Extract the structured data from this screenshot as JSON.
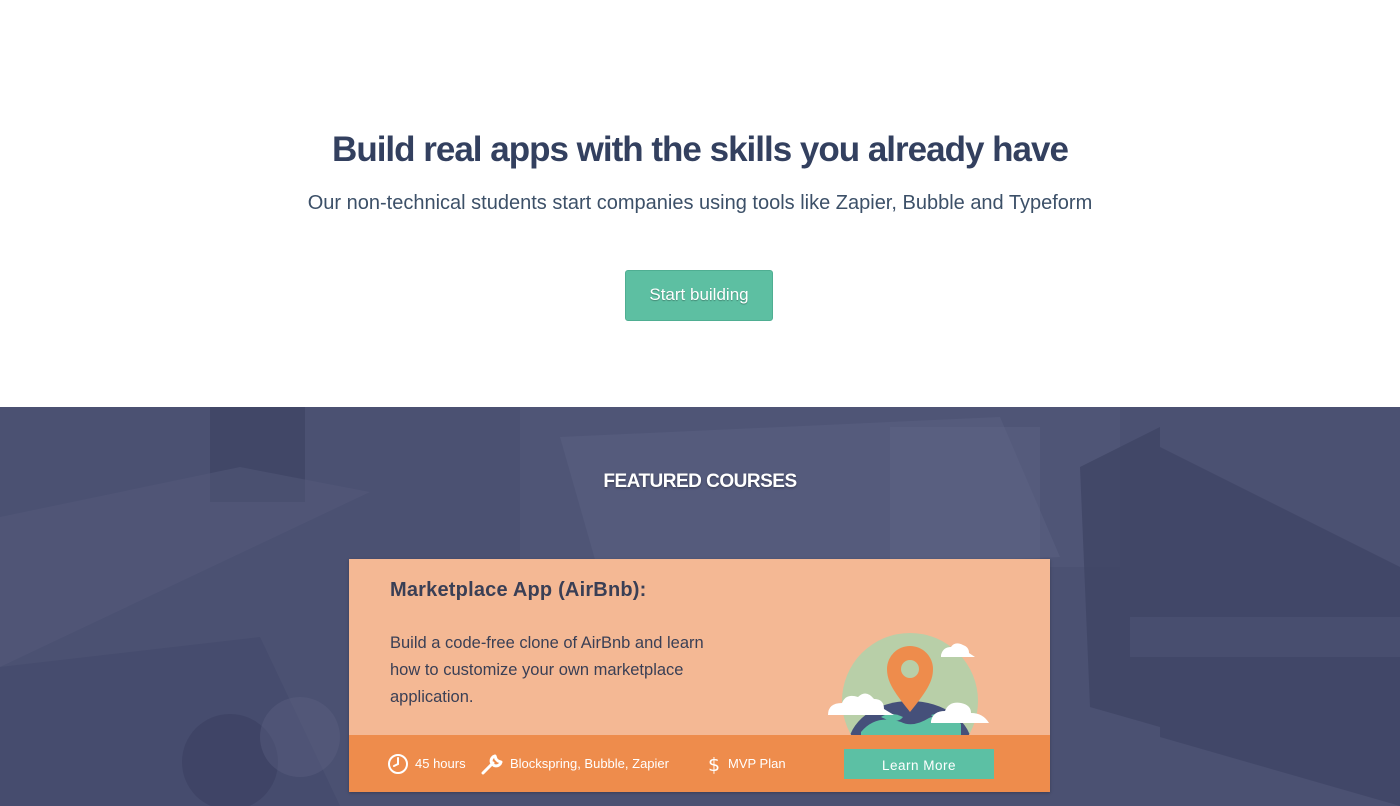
{
  "hero": {
    "title": "Build real apps with the skills you already have",
    "subtitle": "Our non-technical students start companies using tools like Zapier, Bubble and Typeform",
    "cta_label": "Start building"
  },
  "featured": {
    "heading": "FEATURED COURSES",
    "course": {
      "title": "Marketplace App (AirBnb):",
      "description": "Build a code-free clone of AirBnb and learn how to customize your own marketplace application.",
      "duration": "45 hours",
      "tools": "Blockspring, Bubble, Zapier",
      "plan": "MVP Plan",
      "button_label": "Learn More",
      "icons": [
        "clock-icon",
        "wrench-icon",
        "dollar-icon",
        "globe-map-pin-illustration"
      ]
    }
  },
  "colors": {
    "title_text": "#33405f",
    "accent_green": "#5dbfa2",
    "featured_bg": "#4b5172",
    "card_bg": "#f4b894",
    "card_footer": "#ee8c4c"
  }
}
